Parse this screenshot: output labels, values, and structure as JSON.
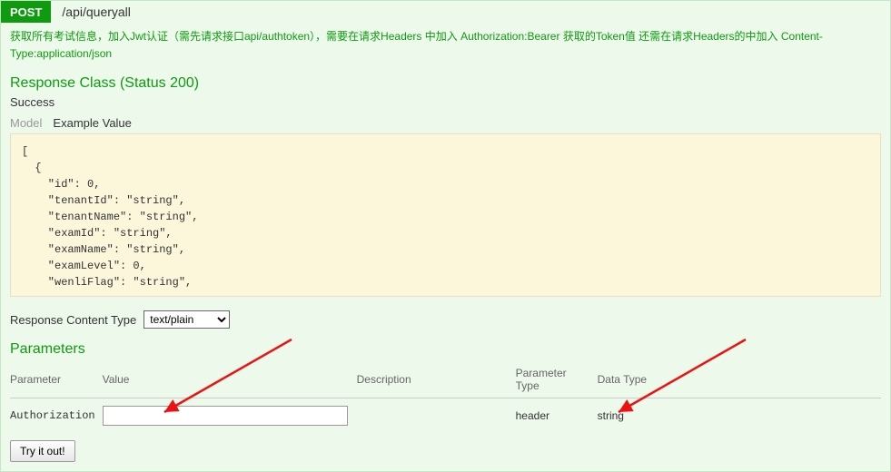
{
  "op": {
    "method": "POST",
    "path": "/api/queryall",
    "description": "获取所有考试信息，加入Jwt认证（需先请求接口api/authtoken），需要在请求Headers 中加入 Authorization:Bearer 获取的Token值 还需在请求Headers的中加入 Content-Type:application/json"
  },
  "response": {
    "header": "Response Class (Status 200)",
    "status_text": "Success",
    "tabs": {
      "model": "Model",
      "example": "Example Value"
    },
    "example_body": "[\n  {\n    \"id\": 0,\n    \"tenantId\": \"string\",\n    \"tenantName\": \"string\",\n    \"examId\": \"string\",\n    \"examName\": \"string\",\n    \"examLevel\": 0,\n    \"wenliFlag\": \"string\",\n    "
  },
  "content_type": {
    "label": "Response Content Type",
    "selected": "text/plain"
  },
  "parameters": {
    "header": "Parameters",
    "columns": {
      "param": "Parameter",
      "value": "Value",
      "desc": "Description",
      "ptype": "Parameter Type",
      "dtype": "Data Type"
    },
    "rows": [
      {
        "name": "Authorization",
        "value": "",
        "desc": "",
        "ptype": "header",
        "dtype": "string"
      }
    ]
  },
  "try_button": "Try it out!"
}
